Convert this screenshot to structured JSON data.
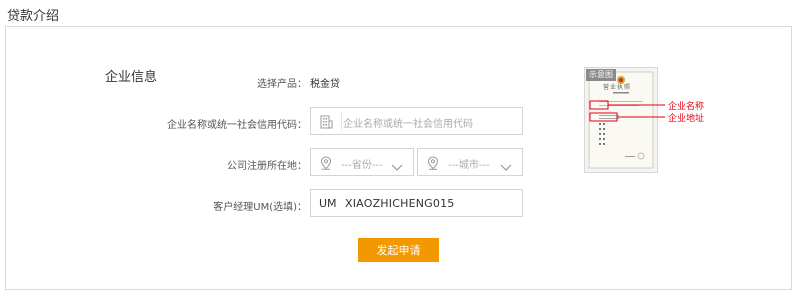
{
  "page": {
    "title": "贷款介绍"
  },
  "section": {
    "title": "企业信息"
  },
  "form": {
    "product": {
      "label": "选择产品：",
      "value": "税金贷"
    },
    "company": {
      "label": "企业名称或统一社会信用代码：",
      "placeholder": "企业名称或统一社会信用代码"
    },
    "location": {
      "label": "公司注册所在地：",
      "province_placeholder": "---省份---",
      "city_placeholder": "---城市---"
    },
    "manager": {
      "label": "客户经理UM(选填)：",
      "prefix": "UM",
      "value": "XIAOZHICHENG015"
    },
    "submit_label": "发起申请"
  },
  "sample": {
    "tag": "示意图",
    "license_title": "营业执照",
    "annotations": [
      "企业名称",
      "企业地址"
    ]
  },
  "colors": {
    "accent": "#f39800",
    "annotation": "#e60012",
    "border": "#d4d4d4"
  }
}
